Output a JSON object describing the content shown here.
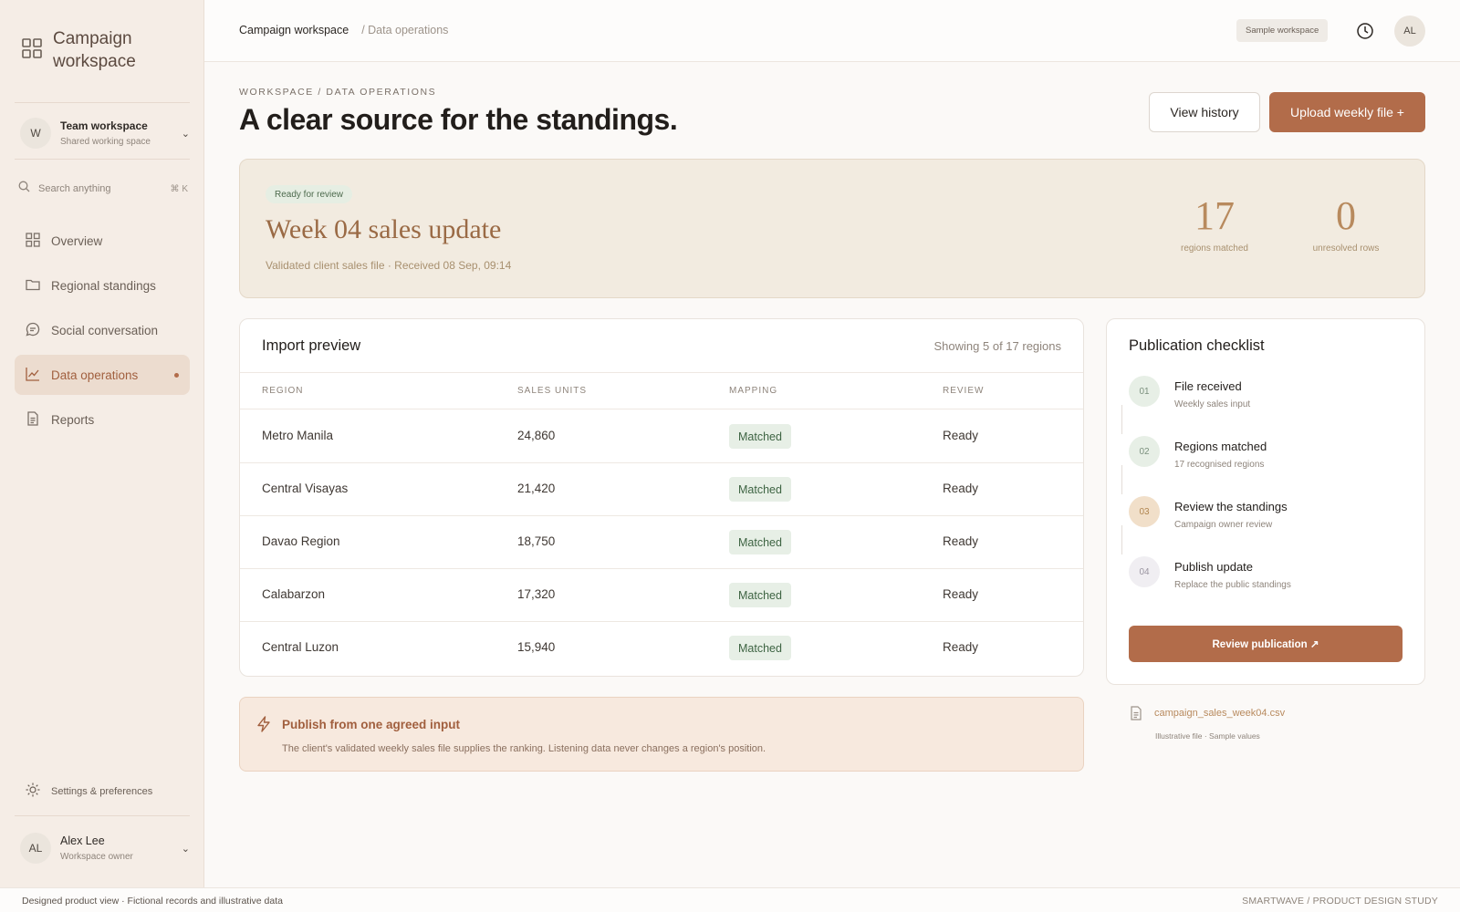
{
  "sidebar": {
    "brand_name": "Campaign workspace",
    "workspace": {
      "avatar": "W",
      "title": "Team workspace",
      "subtitle": "Shared working space"
    },
    "search": {
      "placeholder": "Search anything",
      "shortcut": "⌘ K"
    },
    "nav": [
      {
        "label": "Overview",
        "icon": "grid-icon"
      },
      {
        "label": "Regional standings",
        "icon": "folder-icon"
      },
      {
        "label": "Social conversation",
        "icon": "chat-icon"
      },
      {
        "label": "Data operations",
        "icon": "chart-icon",
        "active": true
      },
      {
        "label": "Reports",
        "icon": "document-icon"
      }
    ],
    "settings_label": "Settings & preferences",
    "user": {
      "avatar": "AL",
      "name": "Alex Lee",
      "role": "Workspace owner"
    }
  },
  "topbar": {
    "crumb_root": "Campaign workspace",
    "crumb_current": "/ Data operations",
    "workspace_pill": "Sample workspace",
    "avatar": "AL"
  },
  "header": {
    "eyebrow": "WORKSPACE / DATA OPERATIONS",
    "title": "A clear source for the standings.",
    "view_history": "View history",
    "upload": "Upload weekly file +"
  },
  "banner": {
    "status": "Ready for review",
    "title": "Week 04 sales update",
    "subtitle": "Validated client sales file · Received 08 Sep, 09:14",
    "stats": [
      {
        "value": "17",
        "label": "regions matched"
      },
      {
        "value": "0",
        "label": "unresolved rows"
      }
    ]
  },
  "preview": {
    "title": "Import preview",
    "showing": "Showing 5 of 17 regions",
    "columns": [
      "REGION",
      "SALES UNITS",
      "MAPPING",
      "REVIEW"
    ],
    "rows": [
      {
        "region": "Metro Manila",
        "units": "24,860",
        "mapping": "Matched",
        "review": "Ready"
      },
      {
        "region": "Central Visayas",
        "units": "21,420",
        "mapping": "Matched",
        "review": "Ready"
      },
      {
        "region": "Davao Region",
        "units": "18,750",
        "mapping": "Matched",
        "review": "Ready"
      },
      {
        "region": "Calabarzon",
        "units": "17,320",
        "mapping": "Matched",
        "review": "Ready"
      },
      {
        "region": "Central Luzon",
        "units": "15,940",
        "mapping": "Matched",
        "review": "Ready"
      }
    ]
  },
  "checklist": {
    "title": "Publication checklist",
    "steps": [
      {
        "num": "01",
        "title": "File received",
        "sub": "Weekly sales input",
        "state": "done"
      },
      {
        "num": "02",
        "title": "Regions matched",
        "sub": "17 recognised regions",
        "state": "done"
      },
      {
        "num": "03",
        "title": "Review the standings",
        "sub": "Campaign owner review",
        "state": "current"
      },
      {
        "num": "04",
        "title": "Publish update",
        "sub": "Replace the public standings",
        "state": "todo"
      }
    ],
    "button": "Review publication ↗"
  },
  "file": {
    "name": "campaign_sales_week04.csv",
    "meta": "Illustrative file · Sample values"
  },
  "note": {
    "title": "Publish from one agreed input",
    "text": "The client's validated weekly sales file supplies the ranking. Listening data never changes a region's position."
  },
  "footer": {
    "left": "Designed product view · Fictional records and illustrative data",
    "right": "SMARTWAVE / PRODUCT DESIGN STUDY"
  },
  "colors": {
    "accent": "#b26c4a",
    "matched_bg": "#e7efe6",
    "banner_bg": "#f2ebe0"
  }
}
